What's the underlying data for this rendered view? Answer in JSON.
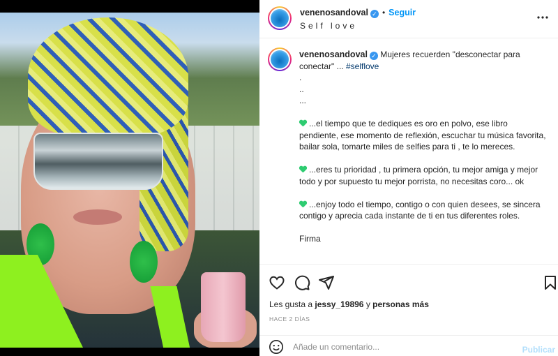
{
  "post": {
    "username": "venenosandoval",
    "verified_badge": "✓",
    "separator": "•",
    "follow_label": "Seguir",
    "subtitle": "Self love",
    "more_icon": "more-horizontal-icon"
  },
  "caption": {
    "username": "venenosandoval",
    "intro": "Mujeres recuerden \"desconectar para conectar\" ...",
    "hashtag": "#selflove",
    "dots": [
      ".",
      "..",
      "..."
    ],
    "paragraph_1": "...el tiempo que te dediques es oro en polvo, ese libro pendiente, ese momento de reflexión, escuchar tu música favorita, bailar sola, tomarte miles de selfies para ti , te lo mereces.",
    "paragraph_2": "...eres tu prioridad , tu primera opción, tu mejor amiga y mejor todo y por supuesto tu mejor porrista, no necesitas coro... ok",
    "paragraph_3": "...enjoy todo el tiempo, contigo o con quien desees, se sincera contigo y aprecia cada instante de ti en tus diferentes roles.",
    "signature": "Firma",
    "heart_color": "#2ecc71"
  },
  "actions": {
    "icons": [
      "heart-icon",
      "comment-icon",
      "share-icon",
      "bookmark-icon"
    ],
    "likes_prefix": "Les gusta a",
    "liked_by": "jessy_19896",
    "likes_joiner": "y",
    "likes_suffix": "personas más",
    "time_ago": "HACE 2 DÍAS"
  },
  "comment": {
    "emoji_icon": "smiley-icon",
    "placeholder": "Añade un comentario...",
    "publish_label": "Publicar"
  },
  "colors": {
    "link_blue": "#0095f6",
    "hashtag_blue": "#00376b",
    "publish_disabled": "#b2dffc",
    "neon_green": "#8ef01f"
  }
}
